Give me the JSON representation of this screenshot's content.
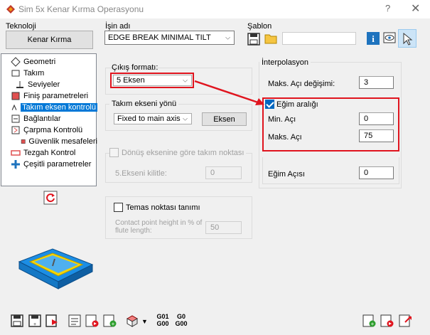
{
  "window": {
    "title": "Sim 5x Kenar Kırma Operasyonu",
    "help": "?",
    "close": "✕"
  },
  "teknoloji": {
    "label": "Teknoloji",
    "button": "Kenar Kırma"
  },
  "isin_adi": {
    "label": "İşin adı",
    "value": "EDGE BREAK MINIMAL TILT"
  },
  "sablon": {
    "label": "Şablon"
  },
  "tree": {
    "items": [
      {
        "label": "Geometri",
        "icon": "geometry-icon"
      },
      {
        "label": "Takım",
        "icon": "tool-icon"
      },
      {
        "label": "Seviyeler",
        "icon": "levels-icon"
      },
      {
        "label": "Finiş parametreleri",
        "icon": "finish-params-icon"
      },
      {
        "label": "Takım eksen kontrolü",
        "icon": "tool-axis-icon",
        "selected": true
      },
      {
        "label": "Bağlantılar",
        "icon": "links-icon"
      },
      {
        "label": "Çarpma Kontrolü",
        "icon": "collision-icon"
      },
      {
        "label": "Güvenlik mesafeleri",
        "icon": "clearance-icon"
      },
      {
        "label": "Tezgah Kontrol",
        "icon": "machine-control-icon"
      },
      {
        "label": "Çeşitli parametreler",
        "icon": "misc-params-icon"
      }
    ]
  },
  "cikis": {
    "label": "Çıkış formatı:",
    "value": "5 Eksen"
  },
  "takim_ekseni": {
    "title": "Takım ekseni yönü",
    "value": "Fixed to main axis",
    "button": "Eksen"
  },
  "donus": {
    "label": "Dönüş eksenine göre takım noktası",
    "locked_label": "5.Ekseni kilitle:",
    "locked_value": "0"
  },
  "temas": {
    "label": "Temas noktası tanımı",
    "desc": "Contact point height in % of flute length:",
    "value": "50"
  },
  "interpolasyon": {
    "title": "İnterpolasyon",
    "max_aci_degisimi_label": "Maks. Açı değişimi:",
    "max_aci_degisimi_value": "3"
  },
  "egim": {
    "checkbox_label": "Eğim aralığı",
    "min_label": "Min. Açı",
    "min_value": "0",
    "max_label": "Maks. Açı",
    "max_value": "75"
  },
  "egim_acisi": {
    "label": "Eğim Açısı",
    "value": "0"
  },
  "toolbar": {
    "g01_top": "G01",
    "g01_bottom": "G00",
    "g0_top": "G0",
    "g0_bottom": "G00"
  },
  "colors": {
    "accent": "#0078d7",
    "highlight": "#e0141e"
  }
}
